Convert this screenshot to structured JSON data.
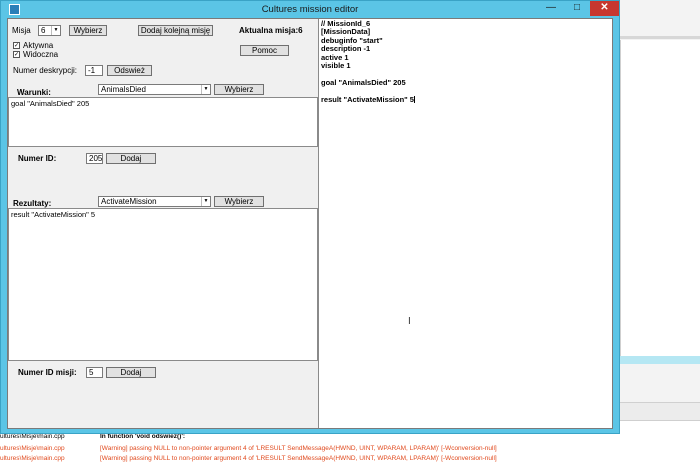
{
  "window": {
    "title": "Cultures mission editor"
  },
  "titlebar": {
    "minimize": "—",
    "maximize": "□",
    "close": "✕"
  },
  "mission": {
    "label": "Misja",
    "selected": "6",
    "choose_button": "Wybierz",
    "add_next_button": "Dodaj kolejną misję",
    "current_label": "Aktualna misja:6",
    "active_label": "Aktywna",
    "active_checked": true,
    "visible_label": "Widoczna",
    "visible_checked": true,
    "help_button": "Pomoc",
    "desc_number_label": "Numer deskrypcji:",
    "desc_number_value": "-1",
    "refresh_button": "Odswież"
  },
  "conditions": {
    "label": "Warunki:",
    "selected": "AnimalsDied",
    "choose_button": "Wybierz",
    "text": "goal \"AnimalsDied\" 205",
    "id_label": "Numer ID:",
    "id_value": "205",
    "add_button": "Dodaj"
  },
  "results": {
    "label": "Rezultaty:",
    "selected": "ActivateMission",
    "choose_button": "Wybierz",
    "text": "result \"ActivateMission\" 5",
    "id_label": "Numer ID misji:",
    "id_value": "5",
    "add_button": "Dodaj"
  },
  "editor": {
    "lines": [
      "// MissionId_6",
      "[MissionData]",
      "debuginfo \"start\"",
      "description -1",
      "active 1",
      "visible 1",
      "",
      "goal \"AnimalsDied\" 205",
      "",
      "result \"ActivateMission\" 5"
    ]
  },
  "build_log": {
    "rows": [
      {
        "file": "ultures\\Misje\\main.cpp",
        "message": "In function 'void odswiez()':"
      },
      {
        "file": "ultures\\Misje\\main.cpp",
        "message": "[Warning] passing NULL to non-pointer argument 4 of 'LRESULT SendMessageA(HWND, UINT, WPARAM, LPARAM)' [-Wconversion-null]"
      },
      {
        "file": "ultures\\Misje\\main.cpp",
        "message": "[Warning] passing NULL to non-pointer argument 4 of 'LRESULT SendMessageA(HWND, UINT, WPARAM, LPARAM)' [-Wconversion-null]"
      }
    ]
  },
  "colors": {
    "title_bar": "#5bc5e6",
    "close_button": "#c7372f",
    "warning_text": "#e04a1e"
  }
}
